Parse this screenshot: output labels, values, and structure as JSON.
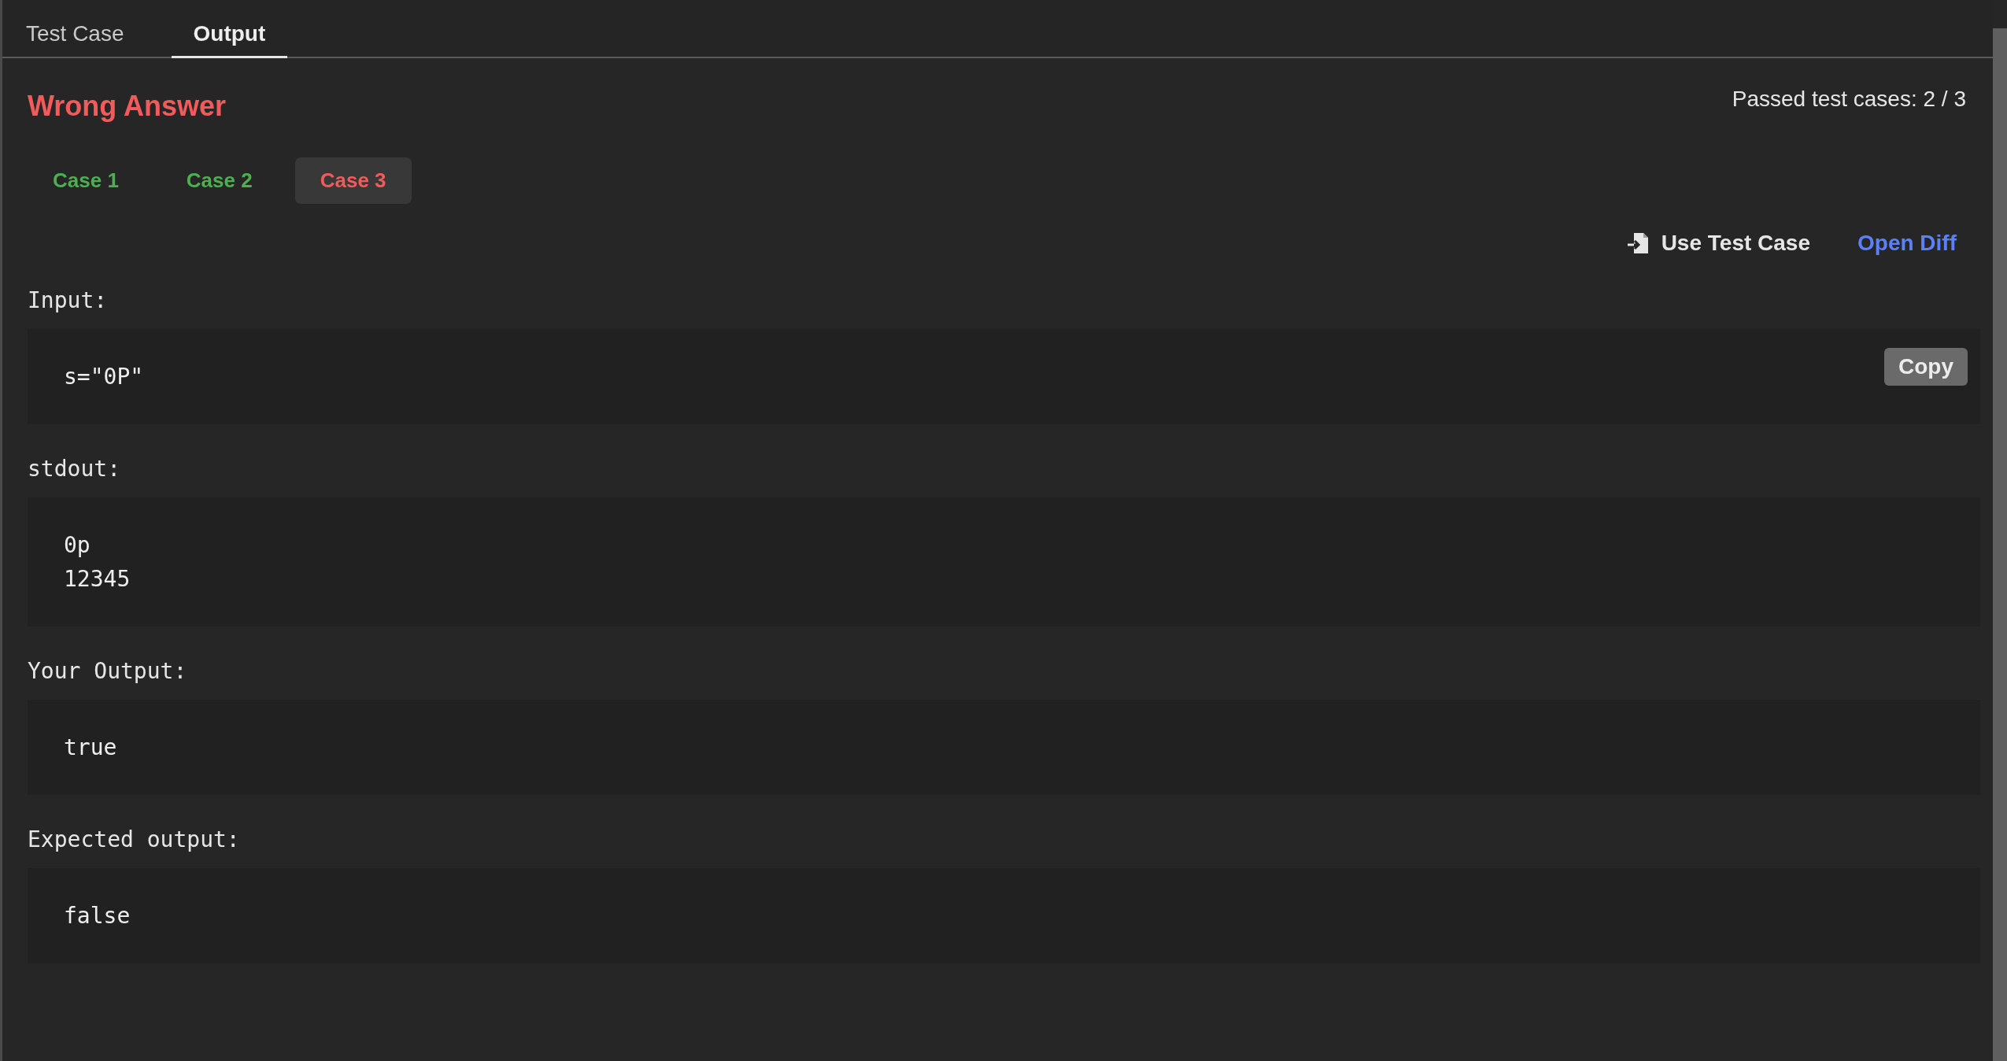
{
  "tabs": [
    {
      "label": "Test Case",
      "selected": false
    },
    {
      "label": "Output",
      "selected": true
    }
  ],
  "result": {
    "title": "Wrong Answer",
    "passed": "Passed test cases: 2 / 3"
  },
  "cases": [
    {
      "label": "Case 1",
      "passed": true,
      "selected": false
    },
    {
      "label": "Case 2",
      "passed": true,
      "selected": false
    },
    {
      "label": "Case 3",
      "passed": false,
      "selected": true
    }
  ],
  "actions": {
    "use_test_case": "Use Test Case",
    "open_diff": "Open Diff"
  },
  "sections": [
    {
      "label": "Input:",
      "lines": [
        "s=\"0P\""
      ],
      "copy": "Copy"
    },
    {
      "label": "stdout:",
      "lines": [
        "0p",
        "12345"
      ]
    },
    {
      "label": "Your Output:",
      "lines": [
        "true"
      ]
    },
    {
      "label": "Expected output:",
      "lines": [
        "false"
      ]
    }
  ]
}
